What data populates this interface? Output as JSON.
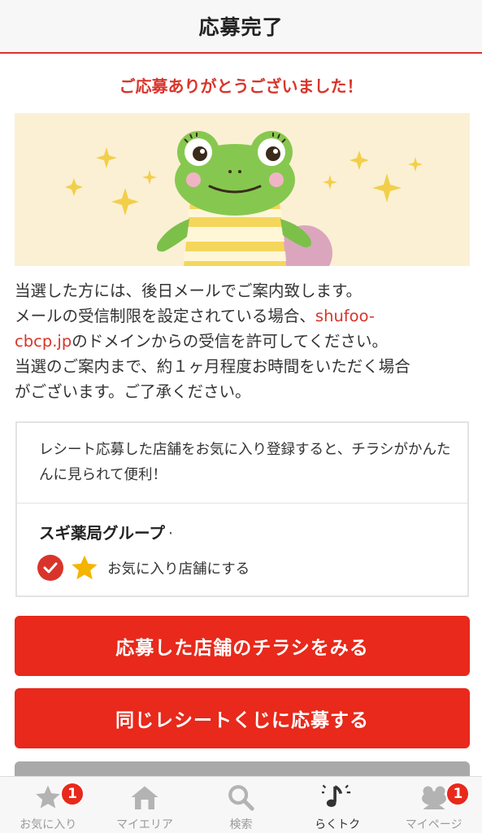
{
  "header": {
    "title": "応募完了"
  },
  "thanks": "ご応募ありがとうございました！",
  "banner": {
    "illustration": "frog-character"
  },
  "message": {
    "line1": "当選した方には、後日メールでご案内致します。",
    "line2_prefix": "メールの受信制限を設定されている場合、",
    "line2_link": "shufoo-",
    "line3_link": "cbcp.jp",
    "line3_suffix": "のドメインからの受信を許可してください。",
    "line4": "当選のご案内まで、約１ヶ月程度お時間をいただく場合",
    "line5": "がございます。ご了承ください。"
  },
  "card": {
    "text": "レシート応募した店舗をお気に入り登録すると、チラシがかんたんに見られて便利！",
    "store_name": "スギ薬局グループ",
    "store_suffix": "·",
    "favorite_label": "お気に入り店舗にする",
    "favorite_checked": true
  },
  "buttons": {
    "view_flyer": "応募した店舗のチラシをみる",
    "apply_same": "同じレシートくじに応募する"
  },
  "tabs": [
    {
      "label": "お気に入り",
      "icon": "star-icon",
      "badge": "1"
    },
    {
      "label": "マイエリア",
      "icon": "house-icon"
    },
    {
      "label": "検索",
      "icon": "search-icon"
    },
    {
      "label": "らくトク",
      "icon": "music-note-icon",
      "active": true
    },
    {
      "label": "マイページ",
      "icon": "frog-icon",
      "badge": "1"
    }
  ],
  "colors": {
    "accent": "#e8291b",
    "text_red": "#d9342b",
    "banner_bg": "#fbf0d4"
  }
}
